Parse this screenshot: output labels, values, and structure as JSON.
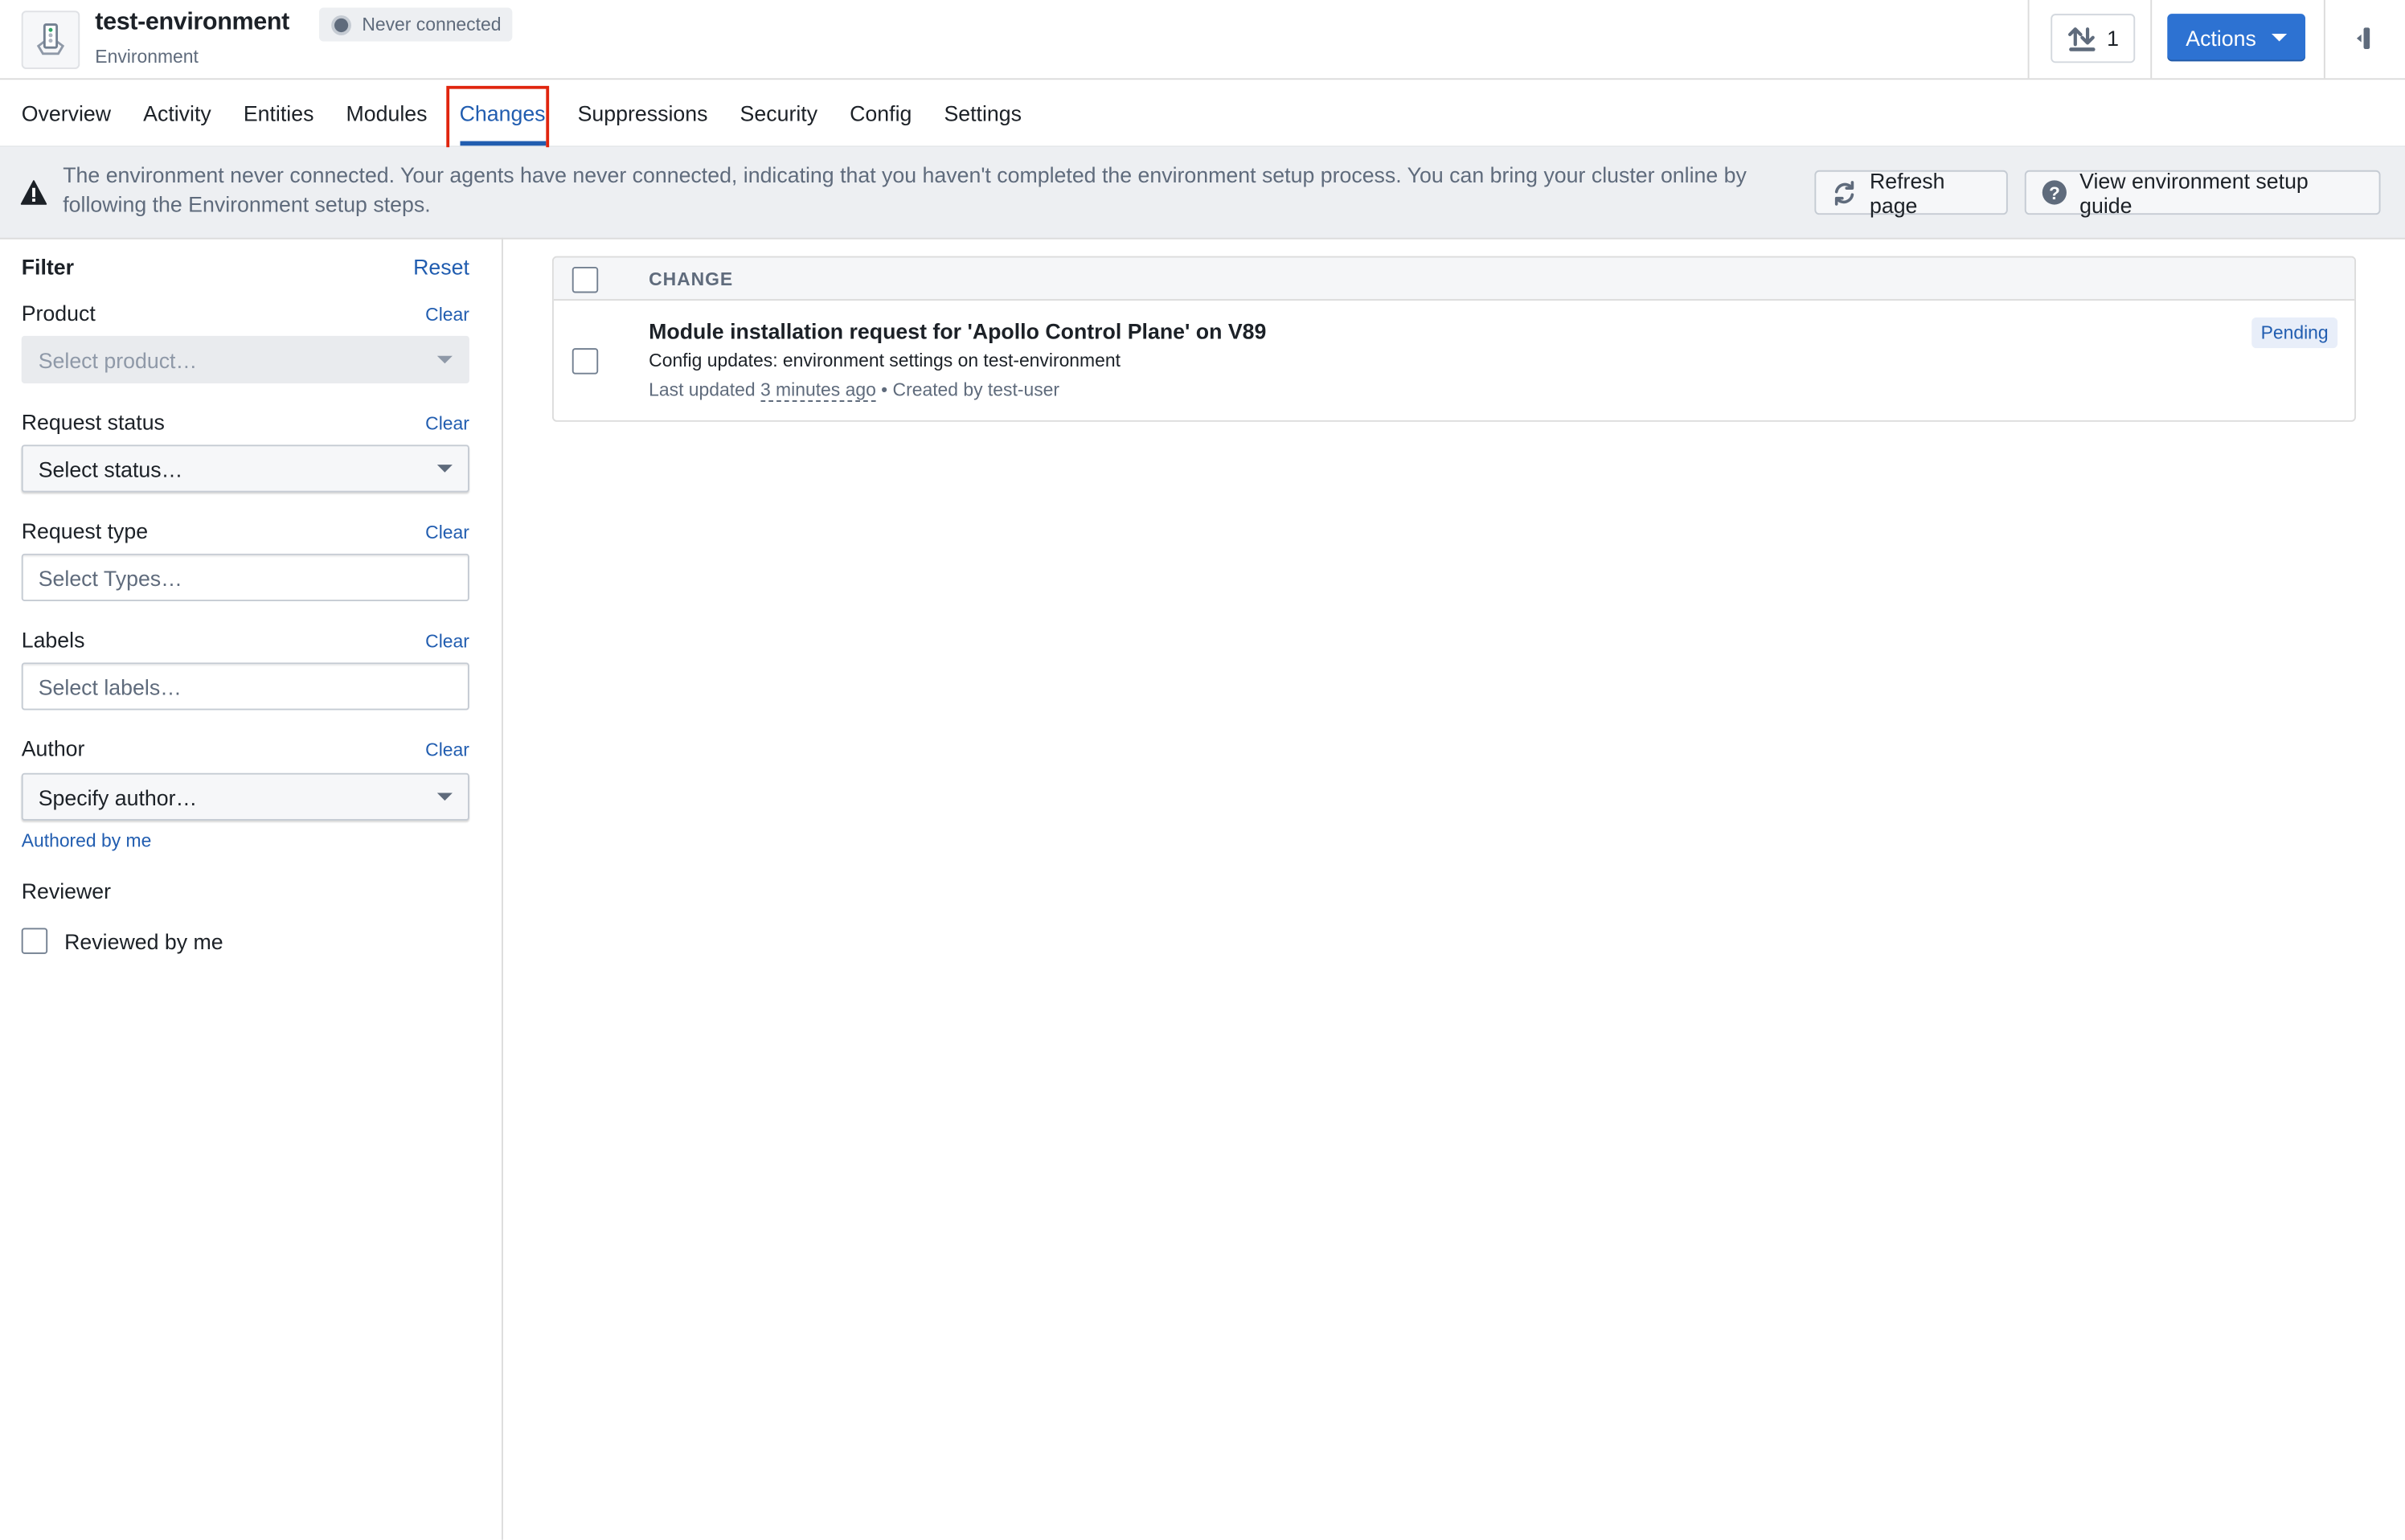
{
  "header": {
    "title": "test-environment",
    "subtitle": "Environment",
    "status": "Never connected",
    "sync_count": "1",
    "actions_label": "Actions"
  },
  "tabs": [
    {
      "label": "Overview",
      "active": false
    },
    {
      "label": "Activity",
      "active": false
    },
    {
      "label": "Entities",
      "active": false
    },
    {
      "label": "Modules",
      "active": false
    },
    {
      "label": "Changes",
      "active": true
    },
    {
      "label": "Suppressions",
      "active": false
    },
    {
      "label": "Security",
      "active": false
    },
    {
      "label": "Config",
      "active": false
    },
    {
      "label": "Settings",
      "active": false
    }
  ],
  "banner": {
    "text": "The environment never connected. Your agents have never connected, indicating that you haven't completed the environment setup process. You can bring your cluster online by following the Environment setup steps.",
    "refresh_label": "Refresh page",
    "guide_label": "View environment setup guide"
  },
  "filter": {
    "title": "Filter",
    "reset_label": "Reset",
    "clear_label": "Clear",
    "product": {
      "label": "Product",
      "placeholder": "Select product…"
    },
    "status": {
      "label": "Request status",
      "placeholder": "Select status…"
    },
    "type": {
      "label": "Request type",
      "placeholder": "Select Types…"
    },
    "labels": {
      "label": "Labels",
      "placeholder": "Select labels…"
    },
    "author": {
      "label": "Author",
      "placeholder": "Specify author…",
      "authored_by_me": "Authored by me"
    },
    "reviewer": {
      "label": "Reviewer",
      "reviewed_by_me": "Reviewed by me"
    }
  },
  "table": {
    "column_header": "CHANGE",
    "rows": [
      {
        "title": "Module installation request for 'Apollo Control Plane' on V89",
        "subtitle": "Config updates:  environment settings on test-environment",
        "last_updated_prefix": "Last updated ",
        "last_updated": "3 minutes ago",
        "created_by": " • Created by test-user",
        "status": "Pending"
      }
    ]
  },
  "colors": {
    "accent": "#2d72d2",
    "link": "#215db0",
    "highlight_box": "#e0250e",
    "banner_bg": "#edeff2"
  }
}
